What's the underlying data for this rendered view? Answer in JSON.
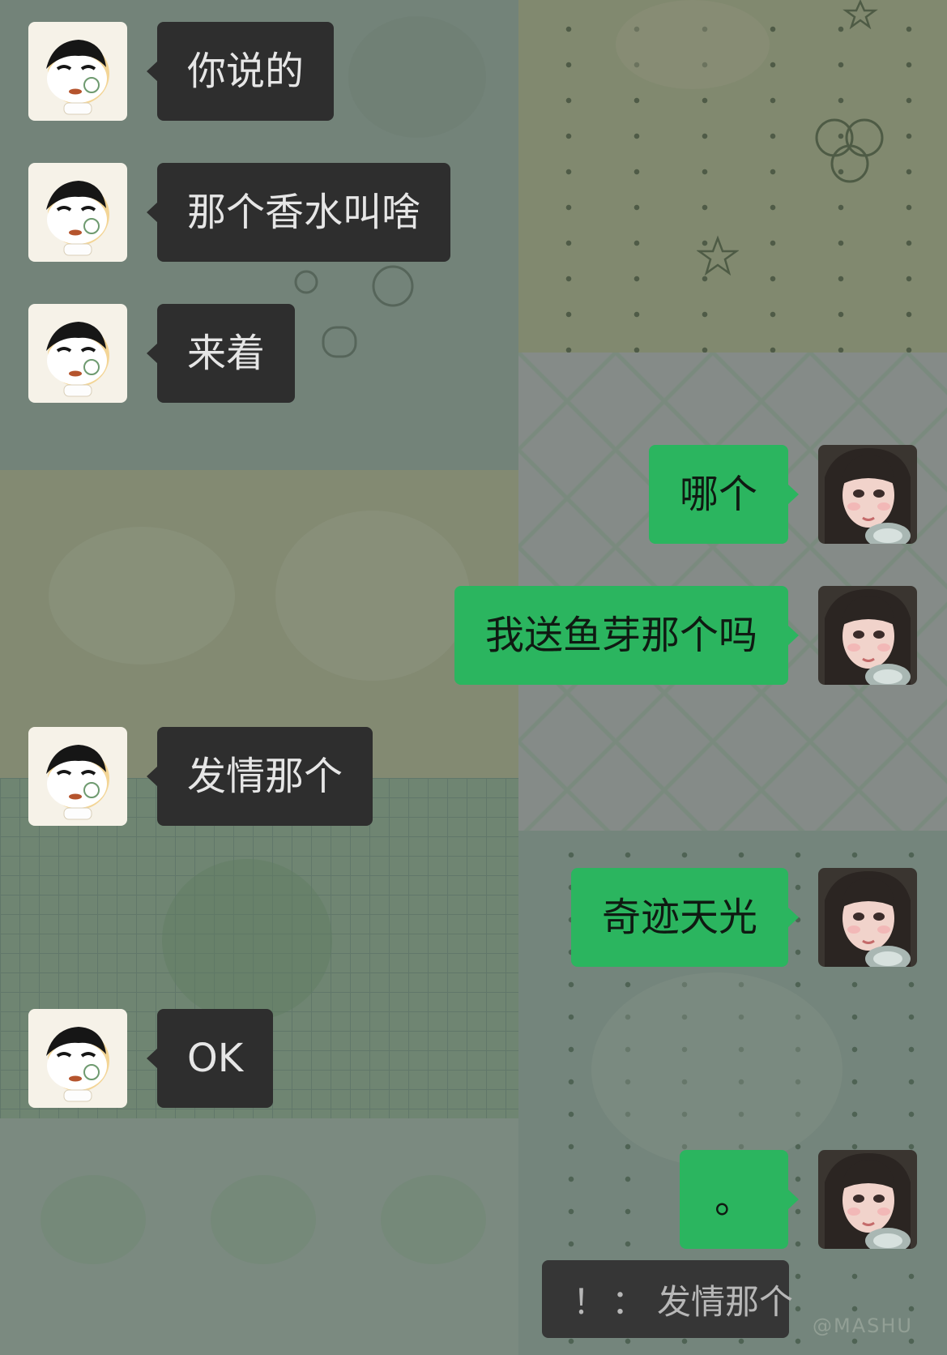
{
  "messages": [
    {
      "side": "in",
      "text": "你说的",
      "avatar": "crayon-shin-chan-avatar"
    },
    {
      "side": "in",
      "text": "那个香水叫啥",
      "avatar": "crayon-shin-chan-avatar"
    },
    {
      "side": "in",
      "text": "来着",
      "avatar": "crayon-shin-chan-avatar"
    },
    {
      "side": "out",
      "text": "哪个",
      "avatar": "girl-selfie-avatar"
    },
    {
      "side": "out",
      "text": "我送鱼芽那个吗",
      "avatar": "girl-selfie-avatar"
    },
    {
      "side": "in",
      "text": "发情那个",
      "avatar": "crayon-shin-chan-avatar"
    },
    {
      "side": "out",
      "text": "奇迹天光",
      "avatar": "girl-selfie-avatar"
    },
    {
      "side": "in",
      "text": "OK",
      "avatar": "crayon-shin-chan-avatar"
    },
    {
      "side": "out",
      "text": "。",
      "avatar": "girl-selfie-avatar"
    }
  ],
  "quote": {
    "sender": "！",
    "separator": "：",
    "text": "发情那个"
  },
  "watermark": "@MASHU",
  "colors": {
    "incoming_bubble": "#2e2e2e",
    "outgoing_bubble": "#2bb55f",
    "incoming_text": "#e6e6e6",
    "outgoing_text": "#0f1a12"
  }
}
